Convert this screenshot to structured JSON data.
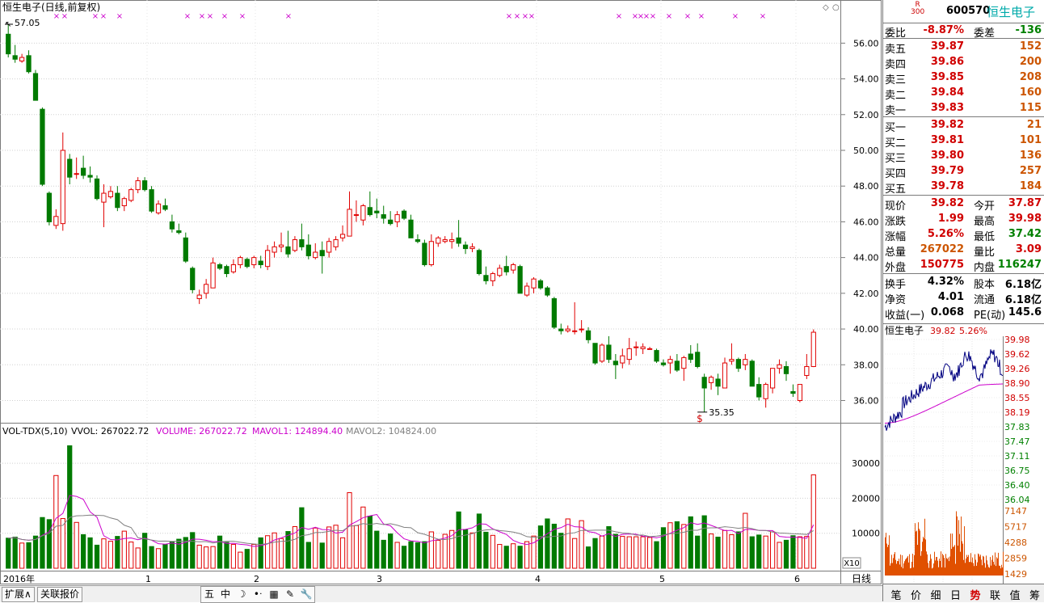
{
  "chart_header": {
    "title": "恒生电子(日线,前复权)",
    "high_label": "57.05",
    "low_label": "35.35",
    "period_label": "日线",
    "zoom_label": "X10"
  },
  "volume_header": {
    "indicator": "VOL-TDX(5,10)",
    "vvol": "VVOL: 267022.72",
    "volume": "VOLUME: 267022.72",
    "mavol1": "MAVOL1: 124894.40",
    "mavol2": "MAVOL2: 104824.00"
  },
  "x_axis_labels": [
    "2016年",
    "1",
    "2",
    "3",
    "4",
    "5",
    "6"
  ],
  "price_axis": [
    "56.00",
    "54.00",
    "52.00",
    "50.00",
    "48.00",
    "46.00",
    "44.00",
    "42.00",
    "40.00",
    "38.00",
    "36.00"
  ],
  "volume_axis": [
    "30000",
    "20000",
    "10000"
  ],
  "chart_data": [
    {
      "type": "candlestick",
      "title": "恒生电子(日线,前复权)",
      "ylim": [
        34.8,
        57.6
      ],
      "ohlc": [
        [
          56.5,
          57.05,
          55.2,
          55.4
        ],
        [
          55.3,
          55.9,
          54.9,
          55.1
        ],
        [
          55.0,
          55.4,
          54.9,
          55.2
        ],
        [
          55.3,
          55.6,
          54.3,
          54.4
        ],
        [
          54.3,
          54.5,
          52.8,
          52.8
        ],
        [
          52.3,
          52.4,
          48.0,
          48.1
        ],
        [
          47.6,
          47.7,
          45.8,
          46.0
        ],
        [
          45.8,
          46.7,
          45.6,
          46.3
        ],
        [
          45.9,
          51.0,
          45.5,
          50.0
        ],
        [
          49.5,
          49.8,
          48.1,
          48.5
        ],
        [
          48.7,
          49.6,
          48.4,
          48.7
        ],
        [
          49.0,
          49.7,
          48.4,
          48.6
        ],
        [
          48.6,
          49.1,
          48.2,
          48.5
        ],
        [
          48.4,
          48.6,
          47.2,
          47.3
        ],
        [
          47.1,
          48.1,
          45.7,
          47.6
        ],
        [
          47.4,
          48.0,
          47.3,
          47.7
        ],
        [
          47.6,
          48.0,
          46.6,
          46.8
        ],
        [
          46.9,
          47.4,
          46.6,
          47.3
        ],
        [
          47.2,
          47.9,
          47.1,
          47.8
        ],
        [
          47.8,
          48.5,
          47.6,
          48.3
        ],
        [
          48.3,
          48.5,
          47.7,
          47.8
        ],
        [
          47.8,
          48.0,
          46.5,
          46.6
        ],
        [
          46.5,
          47.2,
          46.4,
          47.0
        ],
        [
          46.9,
          47.3,
          46.6,
          46.7
        ],
        [
          46.0,
          46.4,
          45.4,
          45.6
        ],
        [
          45.5,
          45.9,
          45.3,
          45.4
        ],
        [
          45.1,
          45.4,
          43.7,
          43.8
        ],
        [
          43.4,
          43.5,
          42.0,
          42.2
        ],
        [
          41.7,
          42.2,
          41.4,
          41.9
        ],
        [
          42.0,
          42.8,
          41.7,
          42.5
        ],
        [
          42.3,
          44.0,
          42.3,
          43.7
        ],
        [
          43.6,
          43.7,
          43.3,
          43.4
        ],
        [
          43.5,
          43.6,
          42.9,
          43.1
        ],
        [
          43.2,
          43.9,
          43.1,
          43.6
        ],
        [
          43.6,
          44.1,
          43.4,
          44.0
        ],
        [
          43.9,
          44.0,
          43.4,
          43.5
        ],
        [
          43.6,
          44.1,
          43.4,
          44.0
        ],
        [
          43.8,
          44.1,
          43.4,
          43.6
        ],
        [
          43.5,
          44.7,
          43.3,
          44.4
        ],
        [
          44.3,
          44.9,
          44.0,
          44.6
        ],
        [
          44.6,
          45.4,
          44.3,
          44.7
        ],
        [
          44.6,
          45.5,
          44.0,
          44.2
        ],
        [
          44.4,
          45.2,
          44.3,
          45.0
        ],
        [
          45.0,
          45.9,
          44.4,
          44.6
        ],
        [
          44.7,
          45.3,
          43.9,
          44.1
        ],
        [
          44.0,
          44.8,
          43.9,
          44.3
        ],
        [
          44.4,
          44.9,
          43.1,
          44.1
        ],
        [
          44.3,
          45.1,
          44.0,
          44.9
        ],
        [
          44.6,
          45.2,
          44.4,
          45.0
        ],
        [
          45.1,
          45.8,
          44.9,
          45.3
        ],
        [
          45.2,
          47.7,
          45.2,
          46.7
        ],
        [
          46.4,
          47.2,
          46.0,
          46.4
        ],
        [
          46.1,
          47.0,
          45.8,
          46.9
        ],
        [
          46.8,
          47.7,
          46.3,
          46.4
        ],
        [
          46.6,
          47.3,
          46.2,
          46.5
        ],
        [
          46.4,
          46.9,
          45.9,
          46.2
        ],
        [
          46.1,
          46.6,
          45.8,
          45.9
        ],
        [
          46.0,
          46.6,
          45.7,
          46.4
        ],
        [
          46.6,
          46.7,
          46.1,
          46.2
        ],
        [
          46.1,
          46.4,
          45.1,
          45.1
        ],
        [
          45.0,
          45.3,
          44.8,
          44.9
        ],
        [
          44.8,
          45.0,
          43.5,
          43.6
        ],
        [
          43.6,
          45.3,
          43.5,
          44.9
        ],
        [
          44.8,
          45.2,
          44.6,
          45.1
        ],
        [
          44.9,
          45.2,
          44.8,
          45.0
        ],
        [
          44.9,
          45.4,
          44.5,
          45.0
        ],
        [
          45.1,
          46.1,
          44.6,
          44.8
        ],
        [
          44.7,
          44.9,
          44.2,
          44.5
        ],
        [
          44.5,
          44.8,
          44.3,
          44.6
        ],
        [
          44.4,
          44.5,
          43.0,
          43.1
        ],
        [
          43.0,
          43.5,
          42.5,
          42.7
        ],
        [
          42.7,
          43.2,
          42.4,
          43.1
        ],
        [
          43.0,
          43.6,
          42.9,
          43.4
        ],
        [
          43.5,
          44.1,
          43.0,
          43.2
        ],
        [
          43.3,
          43.7,
          43.1,
          43.6
        ],
        [
          43.5,
          43.6,
          42.0,
          42.0
        ],
        [
          41.9,
          42.6,
          41.8,
          42.4
        ],
        [
          42.3,
          42.9,
          42.0,
          42.8
        ],
        [
          42.7,
          42.8,
          42.2,
          42.3
        ],
        [
          42.3,
          42.4,
          41.8,
          41.9
        ],
        [
          41.7,
          41.8,
          40.0,
          40.1
        ],
        [
          40.0,
          40.3,
          39.7,
          39.9
        ],
        [
          39.9,
          40.2,
          39.8,
          40.0
        ],
        [
          39.9,
          41.5,
          39.7,
          39.9
        ],
        [
          40.0,
          40.5,
          39.8,
          40.0
        ],
        [
          39.9,
          40.1,
          39.2,
          39.4
        ],
        [
          39.2,
          39.2,
          38.0,
          38.1
        ],
        [
          38.2,
          39.2,
          38.1,
          39.1
        ],
        [
          39.1,
          39.6,
          38.1,
          38.3
        ],
        [
          38.2,
          38.6,
          37.2,
          38.0
        ],
        [
          38.1,
          38.9,
          37.8,
          38.5
        ],
        [
          38.3,
          39.5,
          38.0,
          38.9
        ],
        [
          39.0,
          39.3,
          38.5,
          39.0
        ],
        [
          38.9,
          39.2,
          38.6,
          39.0
        ],
        [
          38.9,
          39.0,
          38.9,
          38.9
        ],
        [
          38.8,
          38.9,
          38.1,
          38.2
        ],
        [
          38.1,
          38.3,
          37.9,
          38.0
        ],
        [
          38.1,
          38.5,
          37.5,
          38.3
        ],
        [
          38.2,
          38.6,
          37.6,
          37.7
        ],
        [
          37.8,
          38.5,
          37.1,
          38.4
        ],
        [
          38.6,
          39.1,
          38.1,
          38.3
        ],
        [
          38.7,
          39.2,
          37.8,
          37.9
        ],
        [
          37.3,
          37.5,
          35.35,
          36.7
        ],
        [
          37.0,
          37.4,
          36.6,
          37.3
        ],
        [
          37.2,
          37.5,
          36.3,
          36.8
        ],
        [
          36.7,
          38.4,
          36.7,
          38.1
        ],
        [
          38.2,
          39.2,
          38.0,
          38.3
        ],
        [
          38.3,
          38.4,
          37.6,
          37.8
        ],
        [
          38.0,
          38.6,
          37.7,
          38.3
        ],
        [
          38.2,
          38.3,
          36.8,
          36.8
        ],
        [
          36.9,
          37.3,
          36.0,
          36.2
        ],
        [
          36.1,
          37.0,
          35.6,
          36.9
        ],
        [
          36.7,
          37.8,
          36.4,
          37.8
        ],
        [
          37.8,
          38.3,
          37.5,
          38.0
        ],
        [
          37.9,
          38.2,
          37.1,
          37.5
        ],
        [
          36.5,
          36.9,
          36.2,
          36.4
        ],
        [
          36.0,
          36.9,
          35.9,
          36.9
        ],
        [
          37.4,
          38.6,
          37.2,
          37.9
        ],
        [
          37.9,
          39.98,
          37.87,
          39.82
        ]
      ],
      "volume": [
        8600,
        8900,
        7200,
        7300,
        9200,
        14500,
        13900,
        26500,
        14200,
        35000,
        13100,
        9600,
        8700,
        6600,
        8400,
        7700,
        9100,
        10600,
        7500,
        5800,
        10000,
        6200,
        5600,
        6800,
        7500,
        8300,
        8800,
        10200,
        6600,
        6100,
        6200,
        9200,
        7400,
        6800,
        4600,
        5400,
        6800,
        8700,
        9300,
        10100,
        8500,
        10500,
        11900,
        17300,
        7400,
        11500,
        7200,
        11800,
        12300,
        8700,
        21600,
        12200,
        17500,
        14900,
        10600,
        8000,
        9800,
        7400,
        6300,
        7600,
        7300,
        7600,
        10400,
        8000,
        9700,
        10800,
        16100,
        11000,
        10100,
        15500,
        10300,
        9400,
        6800,
        6300,
        7000,
        6300,
        7600,
        9200,
        12100,
        14100,
        12600,
        10000,
        14100,
        8500,
        13600,
        6100,
        8500,
        9200,
        11900,
        9700,
        9100,
        9000,
        9000,
        9000,
        8800,
        7600,
        11600,
        13000,
        13300,
        12500,
        14700,
        9200,
        15000,
        9800,
        8900,
        10800,
        9600,
        10400,
        15700,
        9000,
        9500,
        9200,
        10400,
        7400,
        8000,
        9300,
        9000,
        9100,
        26700
      ]
    },
    {
      "type": "line",
      "title": "恒生电子",
      "price": "39.82",
      "pct": "5.26%",
      "left_axis": [
        "39.98",
        "39.62",
        "39.26",
        "38.90",
        "38.55",
        "38.19",
        "37.83",
        "37.47",
        "37.11",
        "36.75",
        "36.40",
        "36.04"
      ],
      "vol_axis": [
        "7147",
        "5717",
        "4288",
        "2859",
        "1429"
      ],
      "ylim": [
        36.04,
        39.98
      ]
    }
  ],
  "quote": {
    "r300": "R\n300",
    "code": "600570",
    "name": "恒生电子",
    "weibi_label": "委比",
    "weibi": "-8.87%",
    "weicha_label": "委差",
    "weicha": "-136",
    "sell": [
      {
        "label": "卖五",
        "price": "39.87",
        "vol": "152"
      },
      {
        "label": "卖四",
        "price": "39.86",
        "vol": "200"
      },
      {
        "label": "卖三",
        "price": "39.85",
        "vol": "208"
      },
      {
        "label": "卖二",
        "price": "39.84",
        "vol": "160"
      },
      {
        "label": "卖一",
        "price": "39.83",
        "vol": "115"
      }
    ],
    "buy": [
      {
        "label": "买一",
        "price": "39.82",
        "vol": "21"
      },
      {
        "label": "买二",
        "price": "39.81",
        "vol": "101"
      },
      {
        "label": "买三",
        "price": "39.80",
        "vol": "136"
      },
      {
        "label": "买四",
        "price": "39.79",
        "vol": "257"
      },
      {
        "label": "买五",
        "price": "39.78",
        "vol": "184"
      }
    ],
    "stats": [
      {
        "l1": "现价",
        "v1": "39.82",
        "c1": "red",
        "l2": "今开",
        "v2": "37.87",
        "c2": "red"
      },
      {
        "l1": "涨跌",
        "v1": "1.99",
        "c1": "red",
        "l2": "最高",
        "v2": "39.98",
        "c2": "red"
      },
      {
        "l1": "涨幅",
        "v1": "5.26%",
        "c1": "red",
        "l2": "最低",
        "v2": "37.42",
        "c2": "grn"
      },
      {
        "l1": "总量",
        "v1": "267022",
        "c1": "ora",
        "l2": "量比",
        "v2": "3.09",
        "c2": "red"
      },
      {
        "l1": "外盘",
        "v1": "150775",
        "c1": "red",
        "l2": "内盘",
        "v2": "116247",
        "c2": "grn"
      }
    ],
    "stats2": [
      {
        "l1": "换手",
        "v1": "4.32%",
        "l2": "股本",
        "v2": "6.18亿"
      },
      {
        "l1": "净资",
        "v1": "4.01",
        "l2": "流通",
        "v2": "6.18亿"
      },
      {
        "l1": "收益(一)",
        "v1": "0.068",
        "l2": "PE(动)",
        "v2": "145.6"
      }
    ]
  },
  "bottom_tabs": [
    "笔",
    "价",
    "细",
    "日",
    "势",
    "联",
    "值",
    "筹"
  ],
  "status_tabs": [
    "扩展∧",
    "关联报价"
  ],
  "toolbar_icons": [
    "五",
    "中",
    "☽",
    "•ᐧ",
    "▦",
    "✎",
    "🔧"
  ],
  "colors": {
    "up": "#e00000",
    "down": "#007a00",
    "grid": "#d0d0d0",
    "ma1": "#cc00cc",
    "ma2": "#808080",
    "intraday": "#000080",
    "intraday_avg": "#cc00cc"
  }
}
